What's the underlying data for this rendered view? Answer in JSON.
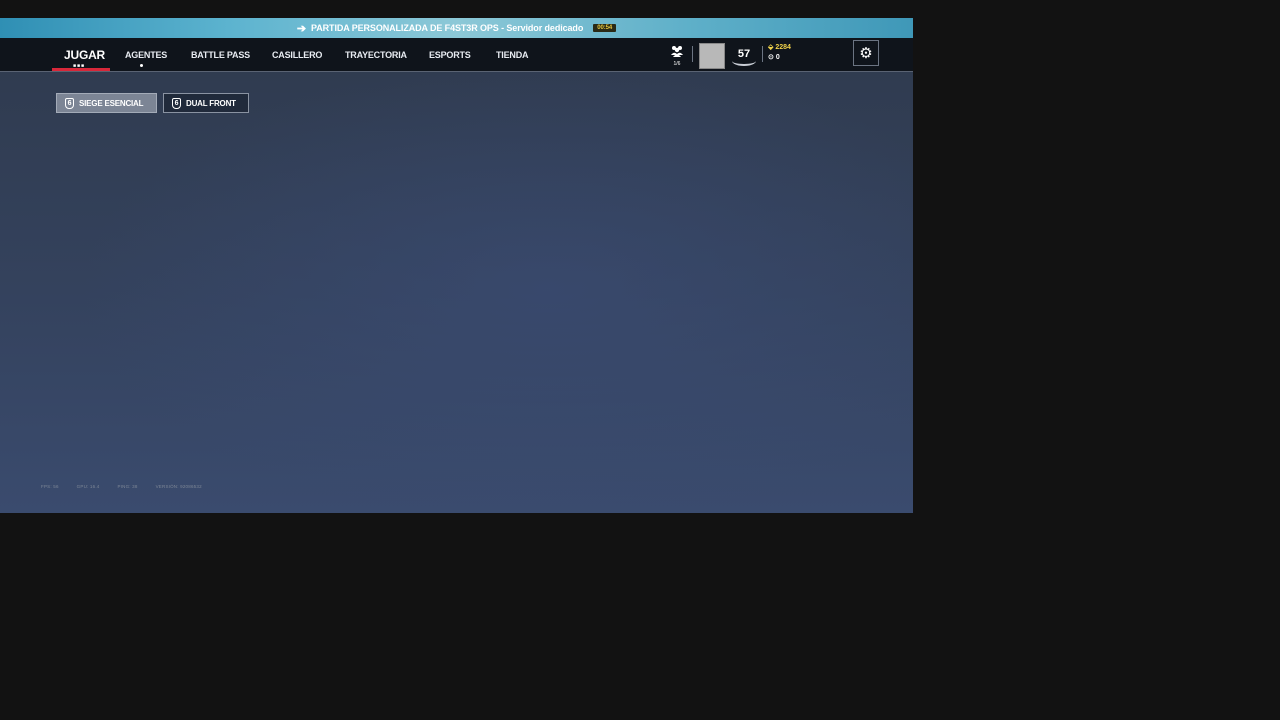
{
  "banner": {
    "text": "PARTIDA PERSONALIZADA DE F4ST3R OPS - Servidor dedicado",
    "timer": "00:54"
  },
  "nav": {
    "items": [
      {
        "label": "JUGAR"
      },
      {
        "label": "AGENTES"
      },
      {
        "label": "BATTLE PASS"
      },
      {
        "label": "CASILLERO"
      },
      {
        "label": "TRAYECTORIA"
      },
      {
        "label": "ESPORTS"
      },
      {
        "label": "TIENDA"
      }
    ],
    "squad_count": "1/6",
    "level": "57",
    "r6_credits": "2284",
    "renown": "0"
  },
  "modes": [
    {
      "label": "SIEGE ESENCIAL",
      "icon_text": "6",
      "selected": true
    },
    {
      "label": "DUAL FRONT",
      "icon_text": "6",
      "selected": false
    }
  ],
  "stats": {
    "fps": "FPS: 56",
    "gpu": "GPU: 16.4",
    "ping": "PING: 38",
    "version": "VERSIÓN: 92086532"
  },
  "colors": {
    "accent_red": "#d8283a",
    "credits_yellow": "#f0d24a",
    "banner_blue": "#5cb3cf"
  }
}
